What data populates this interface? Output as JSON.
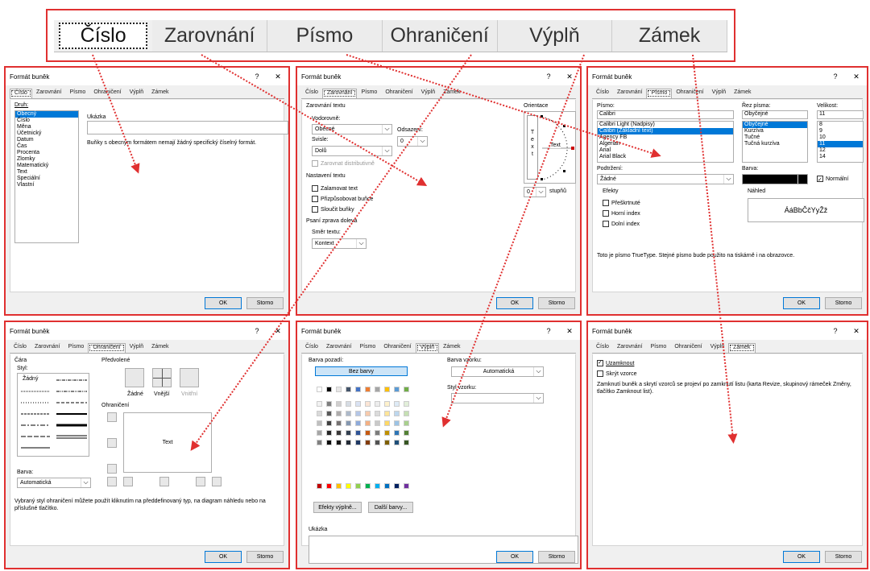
{
  "top_tabs": [
    "Číslo",
    "Zarovnání",
    "Písmo",
    "Ohraničení",
    "Výplň",
    "Zámek"
  ],
  "dialog": {
    "title": "Formát buněk",
    "help": "?",
    "close": "✕",
    "ok": "OK",
    "cancel": "Storno"
  },
  "cislo": {
    "druh_label": "Druh:",
    "categories": [
      "Obecný",
      "Číslo",
      "Měna",
      "Účetnický",
      "Datum",
      "Čas",
      "Procenta",
      "Zlomky",
      "Matematický",
      "Text",
      "Speciální",
      "Vlastní"
    ],
    "sample_label": "Ukázka",
    "description": "Buňky s obecným formátem nemají žádný specifický číselný formát."
  },
  "zarovnani": {
    "group_text_align": "Zarovnání textu",
    "vodorovne_label": "Vodorovně:",
    "vodorovne_value": "Obecné",
    "odsazeni_label": "Odsazení:",
    "odsazeni_value": "0",
    "svisle_label": "Svisle:",
    "svisle_value": "Dolů",
    "distrib": "Zarovnat distributivně",
    "group_text_ctrl": "Nastavení textu",
    "wrap": "Zalamovat text",
    "shrink": "Přizpůsobovat buňce",
    "merge": "Sloučit buňky",
    "group_rtl": "Psaní zprava doleva",
    "smer_label": "Směr textu:",
    "smer_value": "Kontext",
    "orientation_label": "Orientace",
    "orientation_text": "Text",
    "vertical_text": [
      "T",
      "e",
      "x",
      "t"
    ],
    "degrees_value": "0",
    "degrees_label": "stupňů"
  },
  "pismo": {
    "font_label": "Písmo:",
    "font_value": "Calibri",
    "fonts": [
      "Calibri Light (Nadpisy)",
      "Calibri (Základní text)",
      "Agency FB",
      "Algerian",
      "Arial",
      "Arial Black"
    ],
    "style_label": "Řez písma:",
    "style_value": "Obyčejné",
    "styles": [
      "Obyčejné",
      "Kurzíva",
      "Tučné",
      "Tučná kurzíva"
    ],
    "size_label": "Velikost:",
    "size_value": "11",
    "sizes": [
      "8",
      "9",
      "10",
      "11",
      "12",
      "14"
    ],
    "underline_label": "Podtržení:",
    "underline_value": "Žádné",
    "color_label": "Barva:",
    "normal_label": "Normální",
    "effects_label": "Efekty",
    "strike": "Přeškrtnuté",
    "sup": "Horní index",
    "sub": "Dolní index",
    "preview_label": "Náhled",
    "preview_text": "ÁáBbČčYyŽž",
    "note": "Toto je písmo TrueType. Stejné písmo bude použito na tiskárně i na obrazovce."
  },
  "ohraniceni": {
    "line_label": "Čára",
    "style_label": "Styl:",
    "style_none": "Žádný",
    "color_label": "Barva:",
    "color_value": "Automatická",
    "presets_label": "Předvolené",
    "preset_none": "Žádné",
    "preset_outline": "Vnější",
    "preset_inside": "Vnitřní",
    "border_label": "Ohraničení",
    "preview_text": "Text",
    "note": "Vybraný styl ohraničení můžete použít kliknutím na předdefinovaný typ, na diagram náhledu nebo na příslušné tlačítko."
  },
  "vypln": {
    "bg_label": "Barva pozadí:",
    "no_color": "Bez barvy",
    "pattern_color_label": "Barva vzorku:",
    "pattern_color_value": "Automatická",
    "pattern_style_label": "Styl vzorku:",
    "fill_effects": "Efekty výplně...",
    "more_colors": "Další barvy...",
    "sample_label": "Ukázka",
    "palette_top": [
      "#ffffff",
      "#000000",
      "#e7e6e6",
      "#44546a",
      "#4472c4",
      "#ed7d31",
      "#a5a5a5",
      "#ffc000",
      "#5b9bd5",
      "#70ad47"
    ],
    "palette_cols": [
      [
        "#f2f2f2",
        "#d9d9d9",
        "#bfbfbf",
        "#a6a6a6",
        "#808080"
      ],
      [
        "#7f7f7f",
        "#595959",
        "#404040",
        "#262626",
        "#0d0d0d"
      ],
      [
        "#d0cece",
        "#aeabab",
        "#757171",
        "#3a3838",
        "#171616"
      ],
      [
        "#d6dce4",
        "#adb9ca",
        "#8497b0",
        "#333f4f",
        "#222a35"
      ],
      [
        "#d9e2f3",
        "#b4c6e7",
        "#8eaadb",
        "#2f5496",
        "#1f3864"
      ],
      [
        "#fbe5d5",
        "#f7caac",
        "#f4b083",
        "#c55a11",
        "#833c0b"
      ],
      [
        "#ededed",
        "#dbdbdb",
        "#c9c9c9",
        "#7b7b7b",
        "#525252"
      ],
      [
        "#fff2cc",
        "#fee599",
        "#ffd966",
        "#bf9000",
        "#7f6000"
      ],
      [
        "#deebf6",
        "#bdd7ee",
        "#9cc3e5",
        "#2e75b5",
        "#1e4e79"
      ],
      [
        "#e2efd9",
        "#c5e0b3",
        "#a8d08d",
        "#538135",
        "#375623"
      ]
    ],
    "palette_std": [
      "#c00000",
      "#ff0000",
      "#ffc000",
      "#ffff00",
      "#92d050",
      "#00b050",
      "#00b0f0",
      "#0070c0",
      "#002060",
      "#7030a0"
    ]
  },
  "zamek": {
    "locked": "Uzamknout",
    "hidden": "Skrýt vzorce",
    "note": "Zamknutí buněk a skrytí vzorců se projeví po zamknutí listu (karta Revize, skupinový rámeček Změny, tlačítko Zamknout list)."
  },
  "colors": {
    "accent": "#e03030",
    "selection": "#0078d7"
  }
}
